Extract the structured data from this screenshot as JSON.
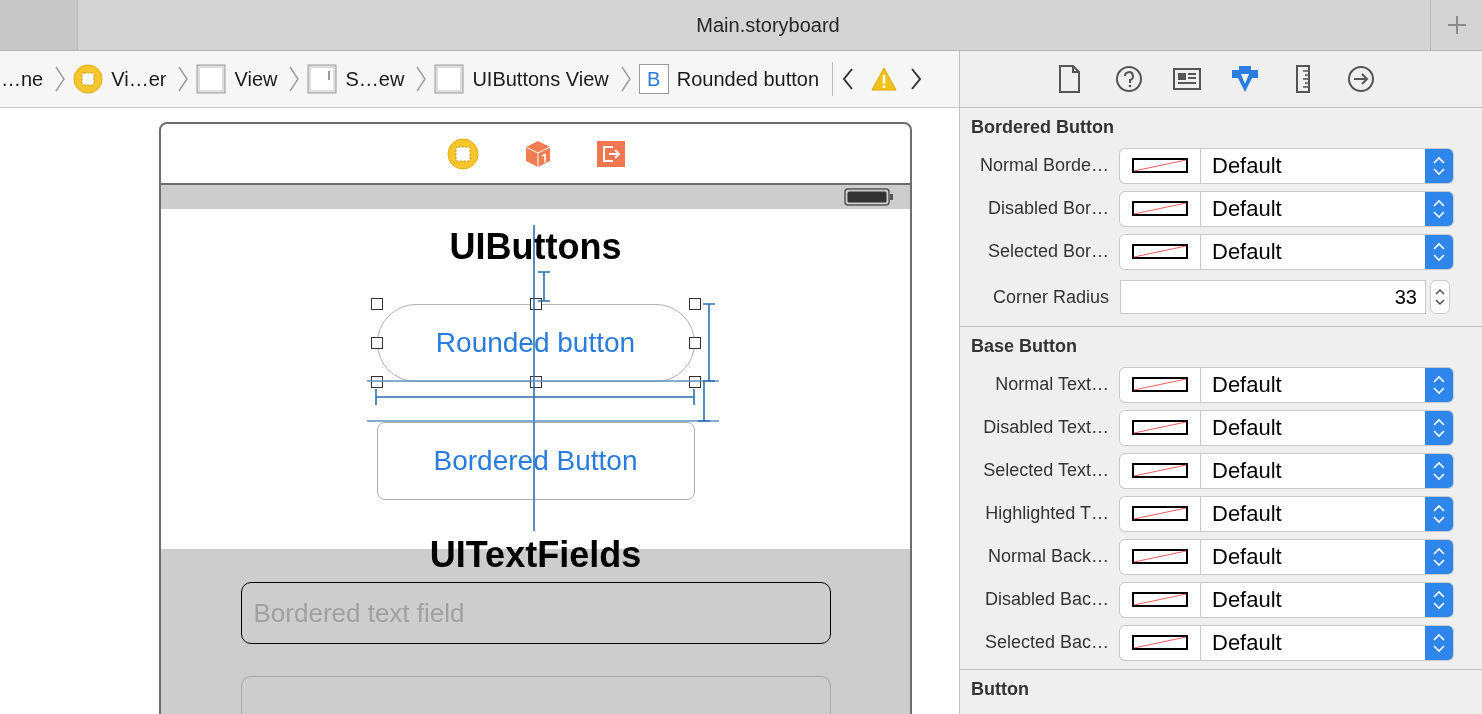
{
  "window": {
    "title": "Main.storyboard"
  },
  "breadcrumbs": [
    {
      "label": "…ne",
      "kind": "none"
    },
    {
      "label": "Vi…er",
      "kind": "controller"
    },
    {
      "label": "View",
      "kind": "view"
    },
    {
      "label": "S…ew",
      "kind": "scroll"
    },
    {
      "label": "UIButtons View",
      "kind": "view"
    },
    {
      "label": "Rounded button",
      "kind": "button",
      "badge": "B"
    }
  ],
  "inspector_tabs": [
    {
      "kind": "file",
      "selected": false
    },
    {
      "kind": "help",
      "selected": false
    },
    {
      "kind": "identity",
      "selected": false
    },
    {
      "kind": "attributes",
      "selected": true
    },
    {
      "kind": "size",
      "selected": false
    },
    {
      "kind": "connections",
      "selected": false
    }
  ],
  "sections": [
    {
      "title": "Bordered Button",
      "properties": [
        {
          "kind": "color",
          "label": "Normal Borde…",
          "value": "Default"
        },
        {
          "kind": "color",
          "label": "Disabled Bor…",
          "value": "Default"
        },
        {
          "kind": "color",
          "label": "Selected Bor…",
          "value": "Default"
        },
        {
          "kind": "number",
          "label": "Corner Radius",
          "value": "33"
        }
      ]
    },
    {
      "title": "Base Button",
      "properties": [
        {
          "kind": "color",
          "label": "Normal Text…",
          "value": "Default"
        },
        {
          "kind": "color",
          "label": "Disabled Text…",
          "value": "Default"
        },
        {
          "kind": "color",
          "label": "Selected Text…",
          "value": "Default"
        },
        {
          "kind": "color",
          "label": "Highlighted T…",
          "value": "Default"
        },
        {
          "kind": "color",
          "label": "Normal Back…",
          "value": "Default"
        },
        {
          "kind": "color",
          "label": "Disabled Bac…",
          "value": "Default"
        },
        {
          "kind": "color",
          "label": "Selected Bac…",
          "value": "Default"
        }
      ]
    },
    {
      "title": "Button"
    }
  ],
  "canvas": {
    "heading_1": "UIButtons",
    "buttons": [
      {
        "label": "Rounded button",
        "kind": "rounded",
        "selected": true
      },
      {
        "label": "Bordered Button",
        "kind": "bordered",
        "selected": false
      }
    ],
    "heading_2": "UITextFields",
    "text_fields": [
      {
        "kind": "bordered",
        "placeholder": "Bordered text field"
      },
      {
        "kind": "rounded"
      }
    ]
  }
}
